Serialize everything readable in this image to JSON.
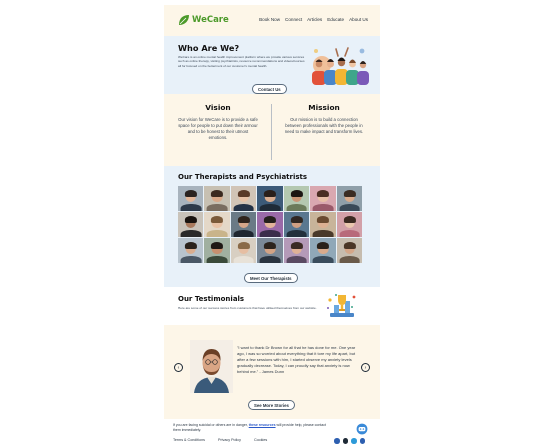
{
  "brand": {
    "name": "WeCare",
    "color": "#4c9a2a"
  },
  "nav": [
    "Book Now",
    "Connect",
    "Articles",
    "Educate",
    "About Us"
  ],
  "about": {
    "title": "Who Are We?",
    "text": "WeCare is an online mental health improvement platform where we provide various services such as online therapy, visiting psychiatrists, resource recommendations and videos/courses all for focused on the betterment of our customer's mental health.",
    "button": "Contact Us"
  },
  "vision": {
    "title": "Vision",
    "text": "Our vision for WeCare is to provide a safe space for people to put down their armour and to be honest to their utmost emotions."
  },
  "mission": {
    "title": "Mission",
    "text": "Our mission is to build a connection between professionals with the people in need to make impact and transform lives."
  },
  "therapists": {
    "title": "Our Therapists and Psychiatrists",
    "button": "Meet Our Therapists",
    "photos": [
      {
        "bg": "#a8b3bd",
        "skin": "#e2b79a",
        "hair": "#2b2320",
        "top": "#2e3a4a"
      },
      {
        "bg": "#c7c0b2",
        "skin": "#d8a98a",
        "hair": "#3b2a20",
        "top": "#7a6d60"
      },
      {
        "bg": "#d1c4b6",
        "skin": "#e6c1a6",
        "hair": "#5a3a28",
        "top": "#243246"
      },
      {
        "bg": "#3c5a78",
        "skin": "#d9ad90",
        "hair": "#2a1f1a",
        "top": "#1f2b38"
      },
      {
        "bg": "#b4c8b0",
        "skin": "#c99676",
        "hair": "#1c1612",
        "top": "#6b7b5a"
      },
      {
        "bg": "#d9a8b0",
        "skin": "#e7bfa6",
        "hair": "#4a2e22",
        "top": "#9a5a6a"
      },
      {
        "bg": "#8f9fa9",
        "skin": "#d8ab8c",
        "hair": "#3a2c22",
        "top": "#3a4a58"
      },
      {
        "bg": "#c9c3ba",
        "skin": "#a97a5e",
        "hair": "#1a1410",
        "top": "#2a2a2a"
      },
      {
        "bg": "#e4d8c8",
        "skin": "#e9c3a7",
        "hair": "#7b5a3a",
        "top": "#c9b48a"
      },
      {
        "bg": "#6a7a86",
        "skin": "#d5a689",
        "hair": "#2f241d",
        "top": "#1f2630"
      },
      {
        "bg": "#9a6aa8",
        "skin": "#e2b49a",
        "hair": "#25201c",
        "top": "#3a2d4a"
      },
      {
        "bg": "#5a7890",
        "skin": "#cfa083",
        "hair": "#302822",
        "top": "#22303c"
      },
      {
        "bg": "#c8b49a",
        "skin": "#dcb092",
        "hair": "#6a4a30",
        "top": "#4a3a2a"
      },
      {
        "bg": "#d2a0a8",
        "skin": "#eac6ae",
        "hair": "#3c2a22",
        "top": "#b86a7a"
      },
      {
        "bg": "#b8c4ce",
        "skin": "#d9ad8f",
        "hair": "#2a221c",
        "top": "#4a5866"
      },
      {
        "bg": "#a0b0a0",
        "skin": "#c58f6e",
        "hair": "#1e1814",
        "top": "#3a4a3a"
      },
      {
        "bg": "#d8cfc2",
        "skin": "#e6bea2",
        "hair": "#8a6a48",
        "top": "#e8e2d8"
      },
      {
        "bg": "#7a8896",
        "skin": "#d2a385",
        "hair": "#2c231c",
        "top": "#2a3440"
      },
      {
        "bg": "#b49ab8",
        "skin": "#e0b296",
        "hair": "#3a2a24",
        "top": "#5a4a62"
      },
      {
        "bg": "#90a8b8",
        "skin": "#d8aa8c",
        "hair": "#2a211a",
        "top": "#3a4c5c"
      },
      {
        "bg": "#c6bcae",
        "skin": "#d4a688",
        "hair": "#4a3626",
        "top": "#6a5a4a"
      }
    ]
  },
  "testimonials": {
    "title": "Our Testimonials",
    "text": "Here are some of our success stories from customers that have utilised themselves from our website.",
    "quote": "\"I want to thank Dr Brown for all that he has done for me. One year ago, I was so worried about everything that it tore my life apart, but after a few sessions with him, I started observe my anxiety levels gradually decrease. Today, I can proudly say that anxiety is now behind me.\" - James Dunn",
    "button": "See More Stories",
    "prev": "‹",
    "next": "›"
  },
  "footer": {
    "note_before": "If you are facing suicidal or others are in danger, ",
    "note_link": "these resources",
    "note_after": " will provide help, please contact them immediately.",
    "links": [
      "Terms & Conditions",
      "Privacy Policy",
      "Cookies"
    ],
    "social": [
      {
        "name": "facebook-icon",
        "color": "#2d5fb0"
      },
      {
        "name": "instagram-icon",
        "color": "#1e2a36"
      },
      {
        "name": "twitter-icon",
        "color": "#2d9ad8"
      },
      {
        "name": "linkedin-icon",
        "color": "#2d5fb0"
      }
    ]
  }
}
